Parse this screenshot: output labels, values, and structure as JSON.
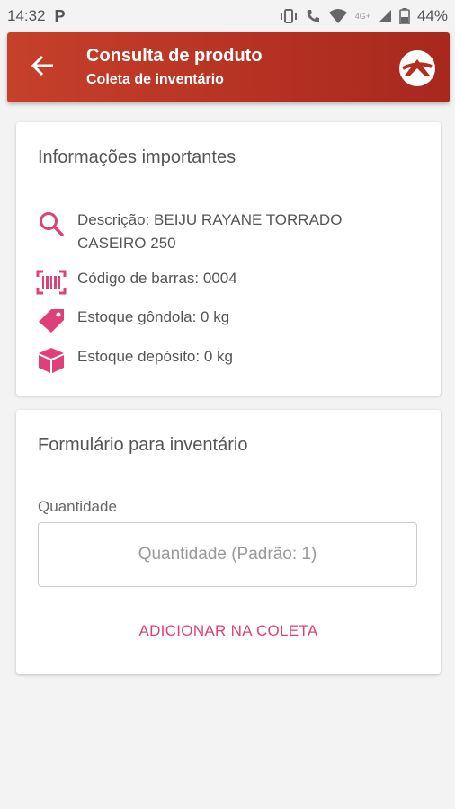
{
  "status_bar": {
    "time": "14:32",
    "app_indicator": "P",
    "network": "4G+",
    "battery": "44%"
  },
  "app_bar": {
    "title": "Consulta de produto",
    "subtitle": "Coleta de inventário"
  },
  "info_card": {
    "title": "Informações importantes",
    "rows": [
      {
        "icon": "search-icon",
        "text": "Descrição: BEIJU RAYANE TORRADO CASEIRO 250"
      },
      {
        "icon": "barcode-icon",
        "text": "Código de barras: 0004"
      },
      {
        "icon": "tag-icon",
        "text": "Estoque gôndola: 0 kg"
      },
      {
        "icon": "box-icon",
        "text": "Estoque depósito: 0 kg"
      }
    ]
  },
  "form_card": {
    "title": "Formulário para inventário",
    "quantity_label": "Quantidade",
    "quantity_placeholder": "Quantidade (Padrão: 1)",
    "quantity_value": "",
    "submit_label": "ADICIONAR NA COLETA"
  },
  "colors": {
    "app_bar_start": "#c6402a",
    "app_bar_end": "#a8281e",
    "accent_pink": "#e0407a",
    "background": "#f3f3f3"
  }
}
